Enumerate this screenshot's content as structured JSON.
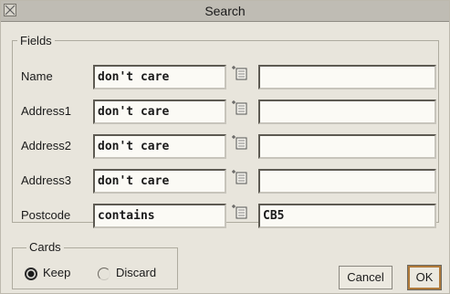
{
  "window": {
    "title": "Search"
  },
  "fields_group": {
    "label": "Fields",
    "rows": [
      {
        "label": "Name",
        "condition": "don't care",
        "value": ""
      },
      {
        "label": "Address1",
        "condition": "don't care",
        "value": ""
      },
      {
        "label": "Address2",
        "condition": "don't care",
        "value": ""
      },
      {
        "label": "Address3",
        "condition": "don't care",
        "value": ""
      },
      {
        "label": "Postcode",
        "condition": "contains",
        "value": "CB5"
      }
    ]
  },
  "cards_group": {
    "label": "Cards",
    "options": [
      {
        "label": "Keep",
        "selected": true
      },
      {
        "label": "Discard",
        "selected": false
      }
    ]
  },
  "buttons": {
    "cancel": "Cancel",
    "ok": "OK"
  },
  "icons": {
    "close": "close-icon",
    "menu": "menu-popup-icon"
  },
  "colors": {
    "titlebar": "#bfbcb4",
    "default_button_ring": "#b07a3a"
  }
}
